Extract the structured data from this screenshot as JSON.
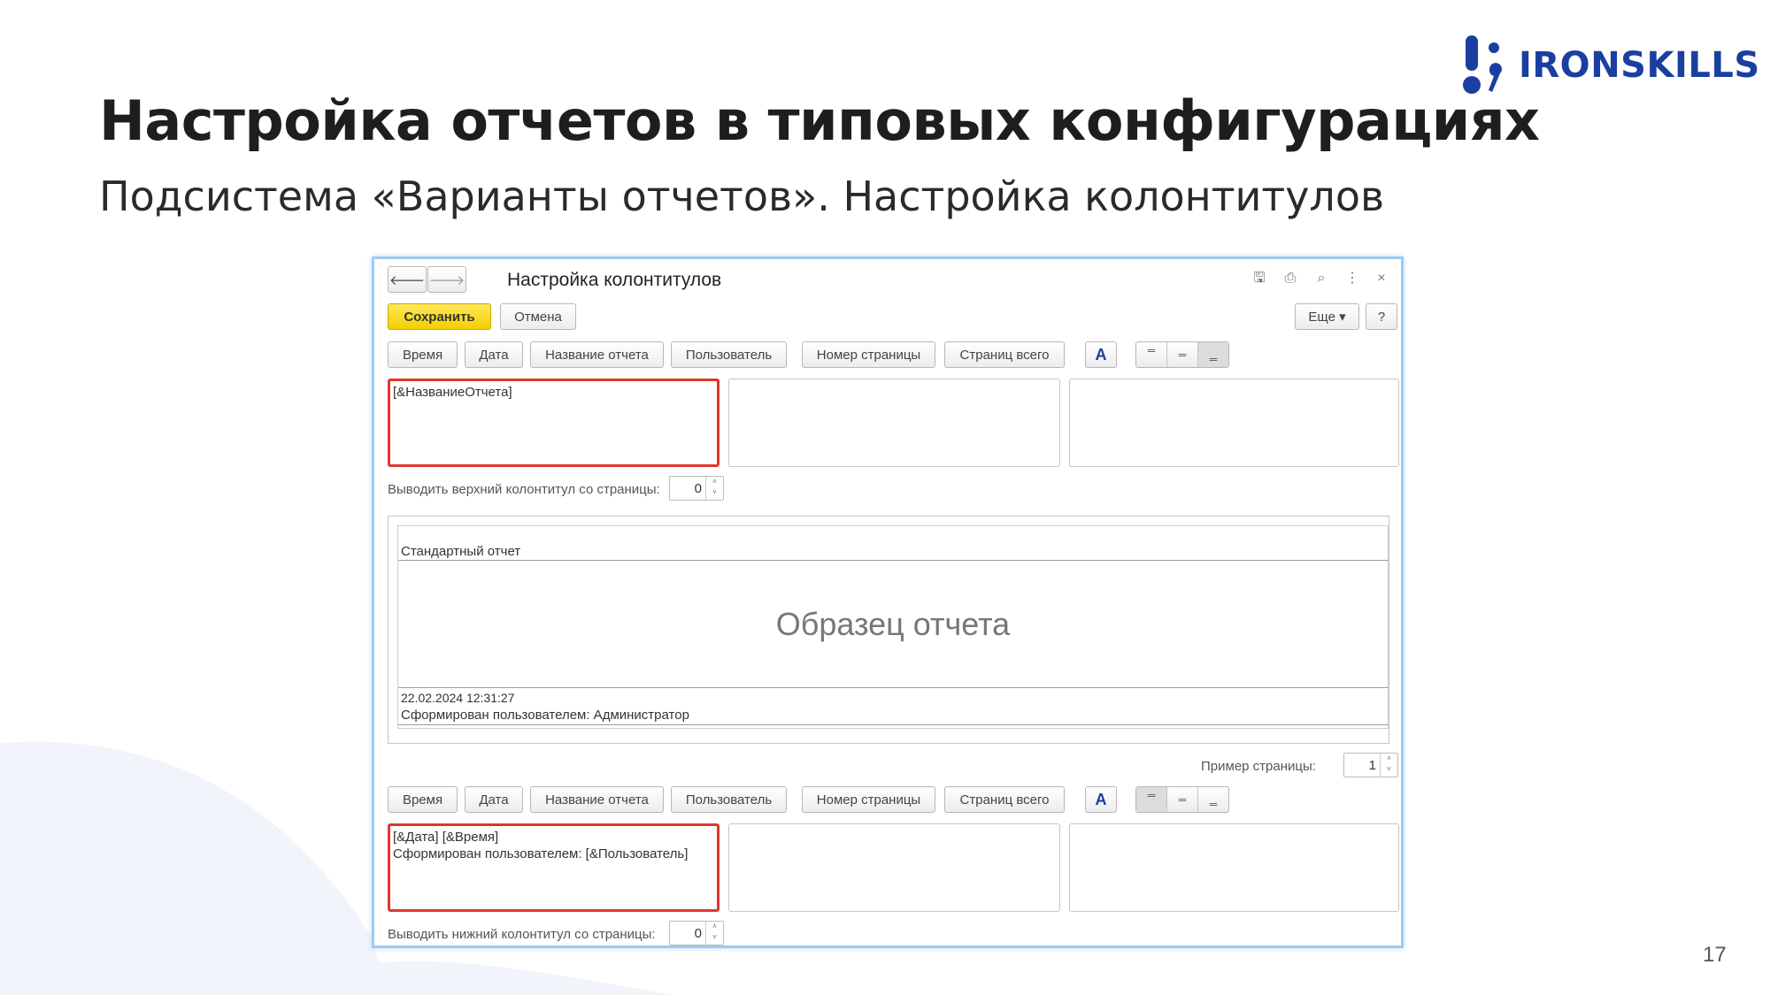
{
  "slide": {
    "title": "Настройка отчетов в типовых конфигурациях",
    "subtitle": "Подсистема «Варианты отчетов». Настройка колонтитулов",
    "logo_text": "IRONSKILLS",
    "page_number": "17",
    "colors": {
      "brand_blue": "#1a3fa0",
      "selection_red": "#e0362c",
      "save_yellow": "#f3cf00",
      "window_border": "#9ccbf2"
    }
  },
  "window": {
    "title": "Настройка колонтитулов",
    "nav": {
      "back_icon": "arrow-left-icon",
      "forward_icon": "arrow-right-icon"
    },
    "title_icons": [
      "save-icon",
      "print-icon",
      "preview-icon",
      "more-icon",
      "close-icon"
    ],
    "toolbar": {
      "save": "Сохранить",
      "cancel": "Отмена",
      "more": "Еще ▾",
      "help": "?"
    },
    "field_buttons": [
      "Время",
      "Дата",
      "Название отчета",
      "Пользователь",
      "Номер страницы",
      "Страниц всего"
    ],
    "font_button": "A",
    "header": {
      "left": "[&НазваниеОтчета]",
      "center": "",
      "right": "",
      "start_page_label": "Выводить верхний колонтитул со страницы:",
      "start_page_value": "0",
      "alignment_selected": "right"
    },
    "preview": {
      "header_text": "Стандартный отчет",
      "sample_text": "Образец отчета",
      "footer_line1": "22.02.2024 12:31:27",
      "footer_line2": "Сформирован пользователем: Администратор"
    },
    "sample_page_label": "Пример страницы:",
    "sample_page_value": "1",
    "footer": {
      "left": "[&Дата] [&Время]\nСформирован пользователем: [&Пользователь]",
      "center": "",
      "right": "",
      "start_page_label": "Выводить нижний колонтитул со страницы:",
      "start_page_value": "0",
      "alignment_selected": "left"
    }
  }
}
